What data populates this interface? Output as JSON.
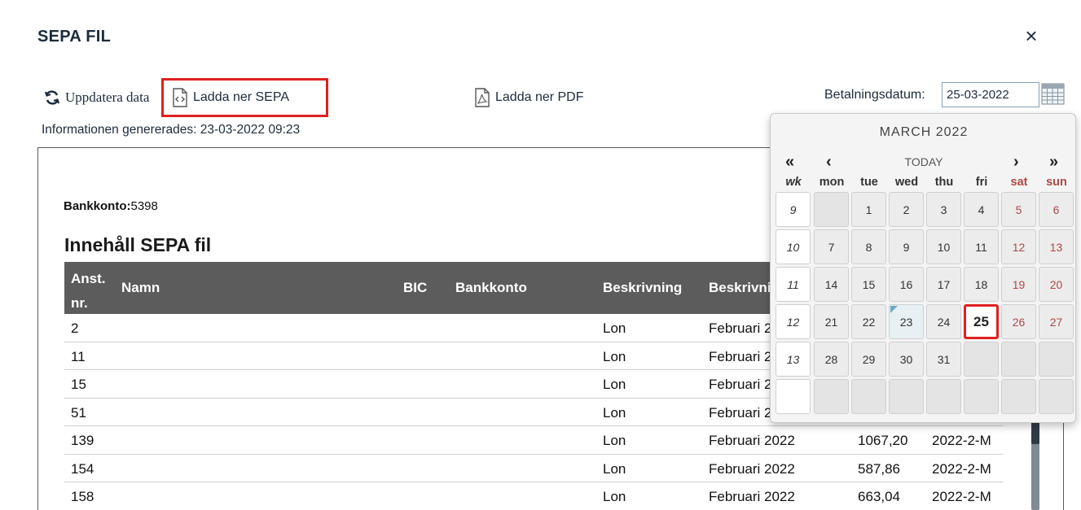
{
  "modal": {
    "title": "SEPA FIL",
    "close_label": "×"
  },
  "toolbar": {
    "refresh_label": "Uppdatera data",
    "download_sepa_label": "Ladda ner SEPA",
    "download_pdf_label": "Ladda ner PDF"
  },
  "payment_date": {
    "label": "Betalningsdatum:",
    "value": "25-03-2022"
  },
  "generated_info": "Informationen genererades: 23-03-2022 09:23",
  "report": {
    "bank_label": "Bankkonto:",
    "bank_value": "5398",
    "title": "Innehåll SEPA fil",
    "columns": [
      "Anst. nr.",
      "Namn",
      "BIC",
      "Bankkonto",
      "Beskrivning",
      "Beskrivning"
    ],
    "rows": [
      {
        "nr": "2",
        "desc": "Lon",
        "desc2": "Februari 2022",
        "amount": "",
        "ref": ""
      },
      {
        "nr": "11",
        "desc": "Lon",
        "desc2": "Februari 2022",
        "amount": "",
        "ref": ""
      },
      {
        "nr": "15",
        "desc": "Lon",
        "desc2": "Februari 2022",
        "amount": "",
        "ref": ""
      },
      {
        "nr": "51",
        "desc": "Lon",
        "desc2": "Februari 2022",
        "amount": "",
        "ref": ""
      },
      {
        "nr": "139",
        "desc": "Lon",
        "desc2": "Februari 2022",
        "amount": "1067,20",
        "ref": "2022-2-M"
      },
      {
        "nr": "154",
        "desc": "Lon",
        "desc2": "Februari 2022",
        "amount": "587,86",
        "ref": "2022-2-M"
      },
      {
        "nr": "158",
        "desc": "Lon",
        "desc2": "Februari 2022",
        "amount": "663,04",
        "ref": "2022-2-M"
      }
    ]
  },
  "calendar": {
    "title": "MARCH 2022",
    "nav": {
      "prev_year": "«",
      "prev_month": "‹",
      "today": "TODAY",
      "next_month": "›",
      "next_year": "»"
    },
    "headers": [
      "wk",
      "mon",
      "tue",
      "wed",
      "thu",
      "fri",
      "sat",
      "sun"
    ],
    "weeks": [
      {
        "wk": "9",
        "days": [
          "",
          "1",
          "2",
          "3",
          "4",
          "5",
          "6"
        ]
      },
      {
        "wk": "10",
        "days": [
          "7",
          "8",
          "9",
          "10",
          "11",
          "12",
          "13"
        ]
      },
      {
        "wk": "11",
        "days": [
          "14",
          "15",
          "16",
          "17",
          "18",
          "19",
          "20"
        ]
      },
      {
        "wk": "12",
        "days": [
          "21",
          "22",
          "23",
          "24",
          "25",
          "26",
          "27"
        ]
      },
      {
        "wk": "13",
        "days": [
          "28",
          "29",
          "30",
          "31",
          "",
          "",
          ""
        ]
      },
      {
        "wk": "",
        "days": [
          "",
          "",
          "",
          "",
          "",
          "",
          ""
        ]
      }
    ],
    "today_day": "23",
    "selected_day": "25",
    "weekend_color": "#b04848",
    "highlight_color": "#e02020"
  }
}
